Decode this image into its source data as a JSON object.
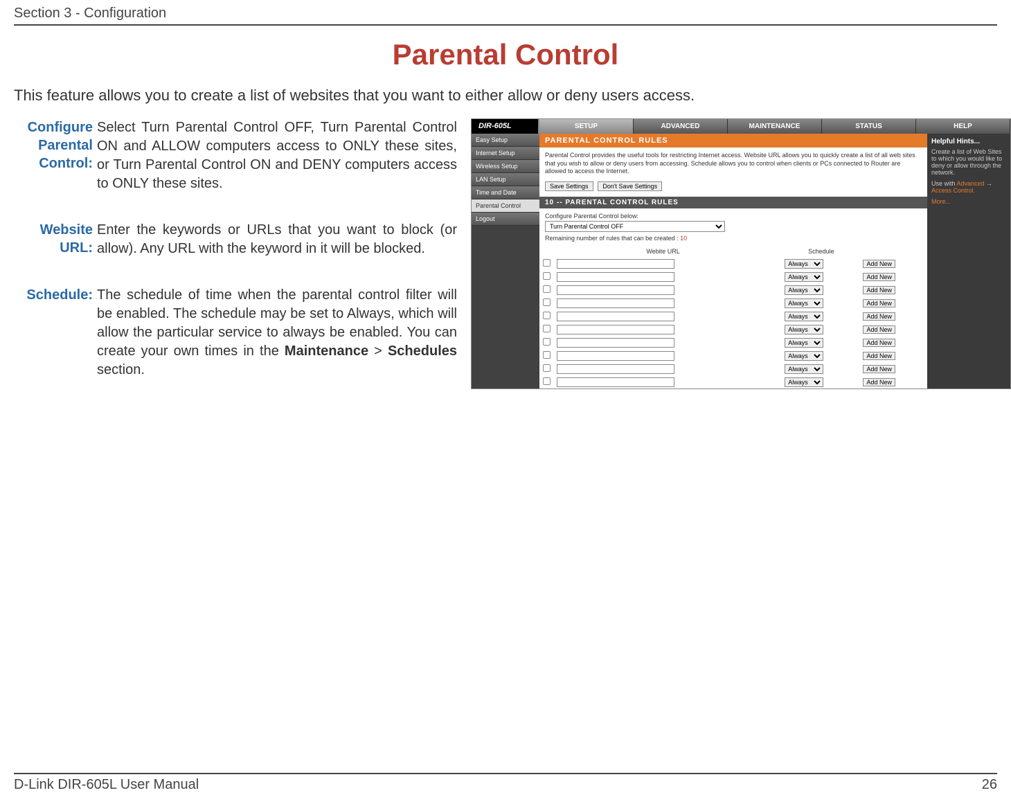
{
  "header": {
    "section": "Section 3 - Configuration"
  },
  "title": "Parental Control",
  "intro": "This feature allows you to create a list of websites that you want to either allow or deny users access.",
  "definitions": [
    {
      "label": "Configure Parental Control:",
      "text": "Select Turn Parental Control OFF, Turn Parental Control ON and ALLOW computers access to ONLY these sites, or Turn Parental Control ON and DENY computers access to ONLY these sites."
    },
    {
      "label": "Website URL:",
      "text": "Enter the keywords or URLs that you want to block (or allow). Any URL with the keyword in it will be blocked."
    },
    {
      "label": "Schedule:",
      "html": "The schedule of time when the parental control filter will be enabled. The schedule may be set to Always, which will allow the particular service to always be enabled. You can create your own times in the <b>Maintenance</b> > <b>Schedules</b> section."
    }
  ],
  "router": {
    "model": "DIR-605L",
    "tabs": [
      "SETUP",
      "ADVANCED",
      "MAINTENANCE",
      "STATUS",
      "HELP"
    ],
    "active_tab": "SETUP",
    "side_items": [
      "Easy Setup",
      "Internet Setup",
      "Wireless Setup",
      "LAN Setup",
      "Time and Date",
      "Parental Control",
      "Logout"
    ],
    "active_side": "Parental Control",
    "banner": "PARENTAL CONTROL RULES",
    "description": "Parental Control provides the useful tools for restricting Internet access. Website URL allows you to quickly create a list of all web sites that you wish to allow or deny users from accessing. Schedule allows you to control when clients or PCs connected to Router are allowed to access the Internet.",
    "buttons": {
      "save": "Save Settings",
      "dont_save": "Don't Save Settings"
    },
    "subhead": "10 -- PARENTAL CONTROL RULES",
    "config_label": "Configure Parental Control below:",
    "select_value": "Turn Parental Control OFF",
    "remaining_prefix": "Remaining number of rules that can be created : ",
    "remaining_count": "10",
    "table": {
      "col_url": "Webite URL",
      "col_schedule": "Schedule",
      "schedule_option": "Always",
      "add_new": "Add New",
      "row_count": 10
    },
    "hints": {
      "title": "Helpful Hints...",
      "body": "Create a list of Web Sites to which you would like to deny or allow through the network.",
      "use_with": "Use with ",
      "link1": "Advanced",
      "arrow": " → ",
      "link2": "Access Control.",
      "more": "More..."
    }
  },
  "footer": {
    "manual": "D-Link DIR-605L User Manual",
    "page": "26"
  }
}
